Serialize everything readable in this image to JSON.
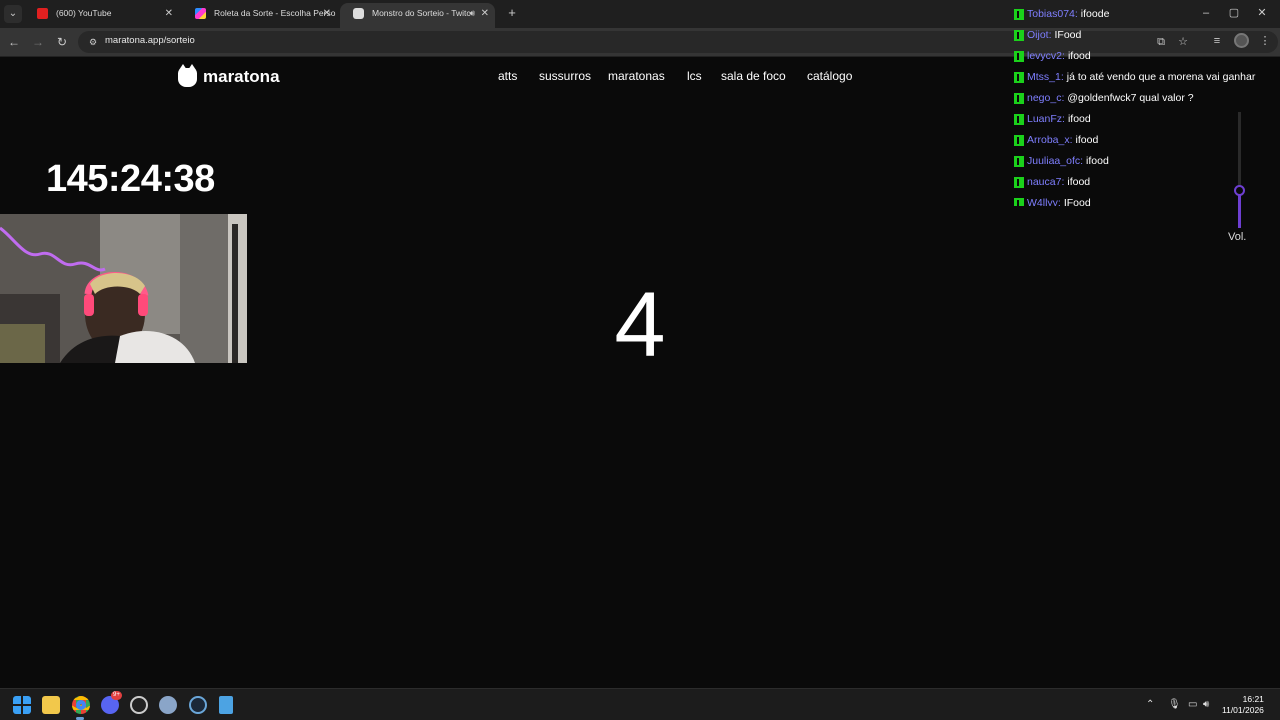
{
  "browser": {
    "tabs": [
      {
        "title": "(600) YouTube",
        "favicon_color": "#e02020",
        "active": false
      },
      {
        "title": "Roleta da Sorte - Escolha Perso",
        "favicon_color": "#d93bb0",
        "active": false
      },
      {
        "title": "Monstro do Sorteio - Twitc",
        "favicon_color": "#dddddd",
        "active": true
      }
    ],
    "new_tab_label": "+",
    "dropdown_label": "⌄",
    "url": "maratona.app/sorteio"
  },
  "site": {
    "brand": "maratona",
    "nav": [
      "atts",
      "sussurros",
      "maratonas",
      "lcs",
      "sala de foco",
      "catálogo"
    ],
    "timer": "145:24:38",
    "countdown": "4"
  },
  "chat": {
    "messages": [
      {
        "user": "Tobias074:",
        "text": "ifoode"
      },
      {
        "user": "Oijot:",
        "text": "IFood"
      },
      {
        "user": "levycv2:",
        "text": "ifood"
      },
      {
        "user": "Mtss_1:",
        "text": "já to até vendo que a morena vai ganhar"
      },
      {
        "user": "nego_c:",
        "text": "@goldenfwck7 qual valor ?"
      },
      {
        "user": "LuanFz:",
        "text": "ifood"
      },
      {
        "user": "Arroba_x:",
        "text": "ifood"
      },
      {
        "user": "Juuliaa_ofc:",
        "text": "ifood"
      },
      {
        "user": "nauca7:",
        "text": "ifood"
      },
      {
        "user": "W4llyy:",
        "text": "IFood"
      }
    ],
    "badge_color": "#1bd11b",
    "username_color": "#7f7fff"
  },
  "volume": {
    "label": "Vol.",
    "level_fraction": 0.33,
    "accent": "#6e3fd2"
  },
  "taskbar": {
    "apps": [
      "windows-start",
      "file-explorer",
      "chrome",
      "discord",
      "obs",
      "settings",
      "steam",
      "notepad"
    ],
    "discord_badge": "9+",
    "clock_time": "16:21",
    "clock_date": "11/01/2026"
  }
}
